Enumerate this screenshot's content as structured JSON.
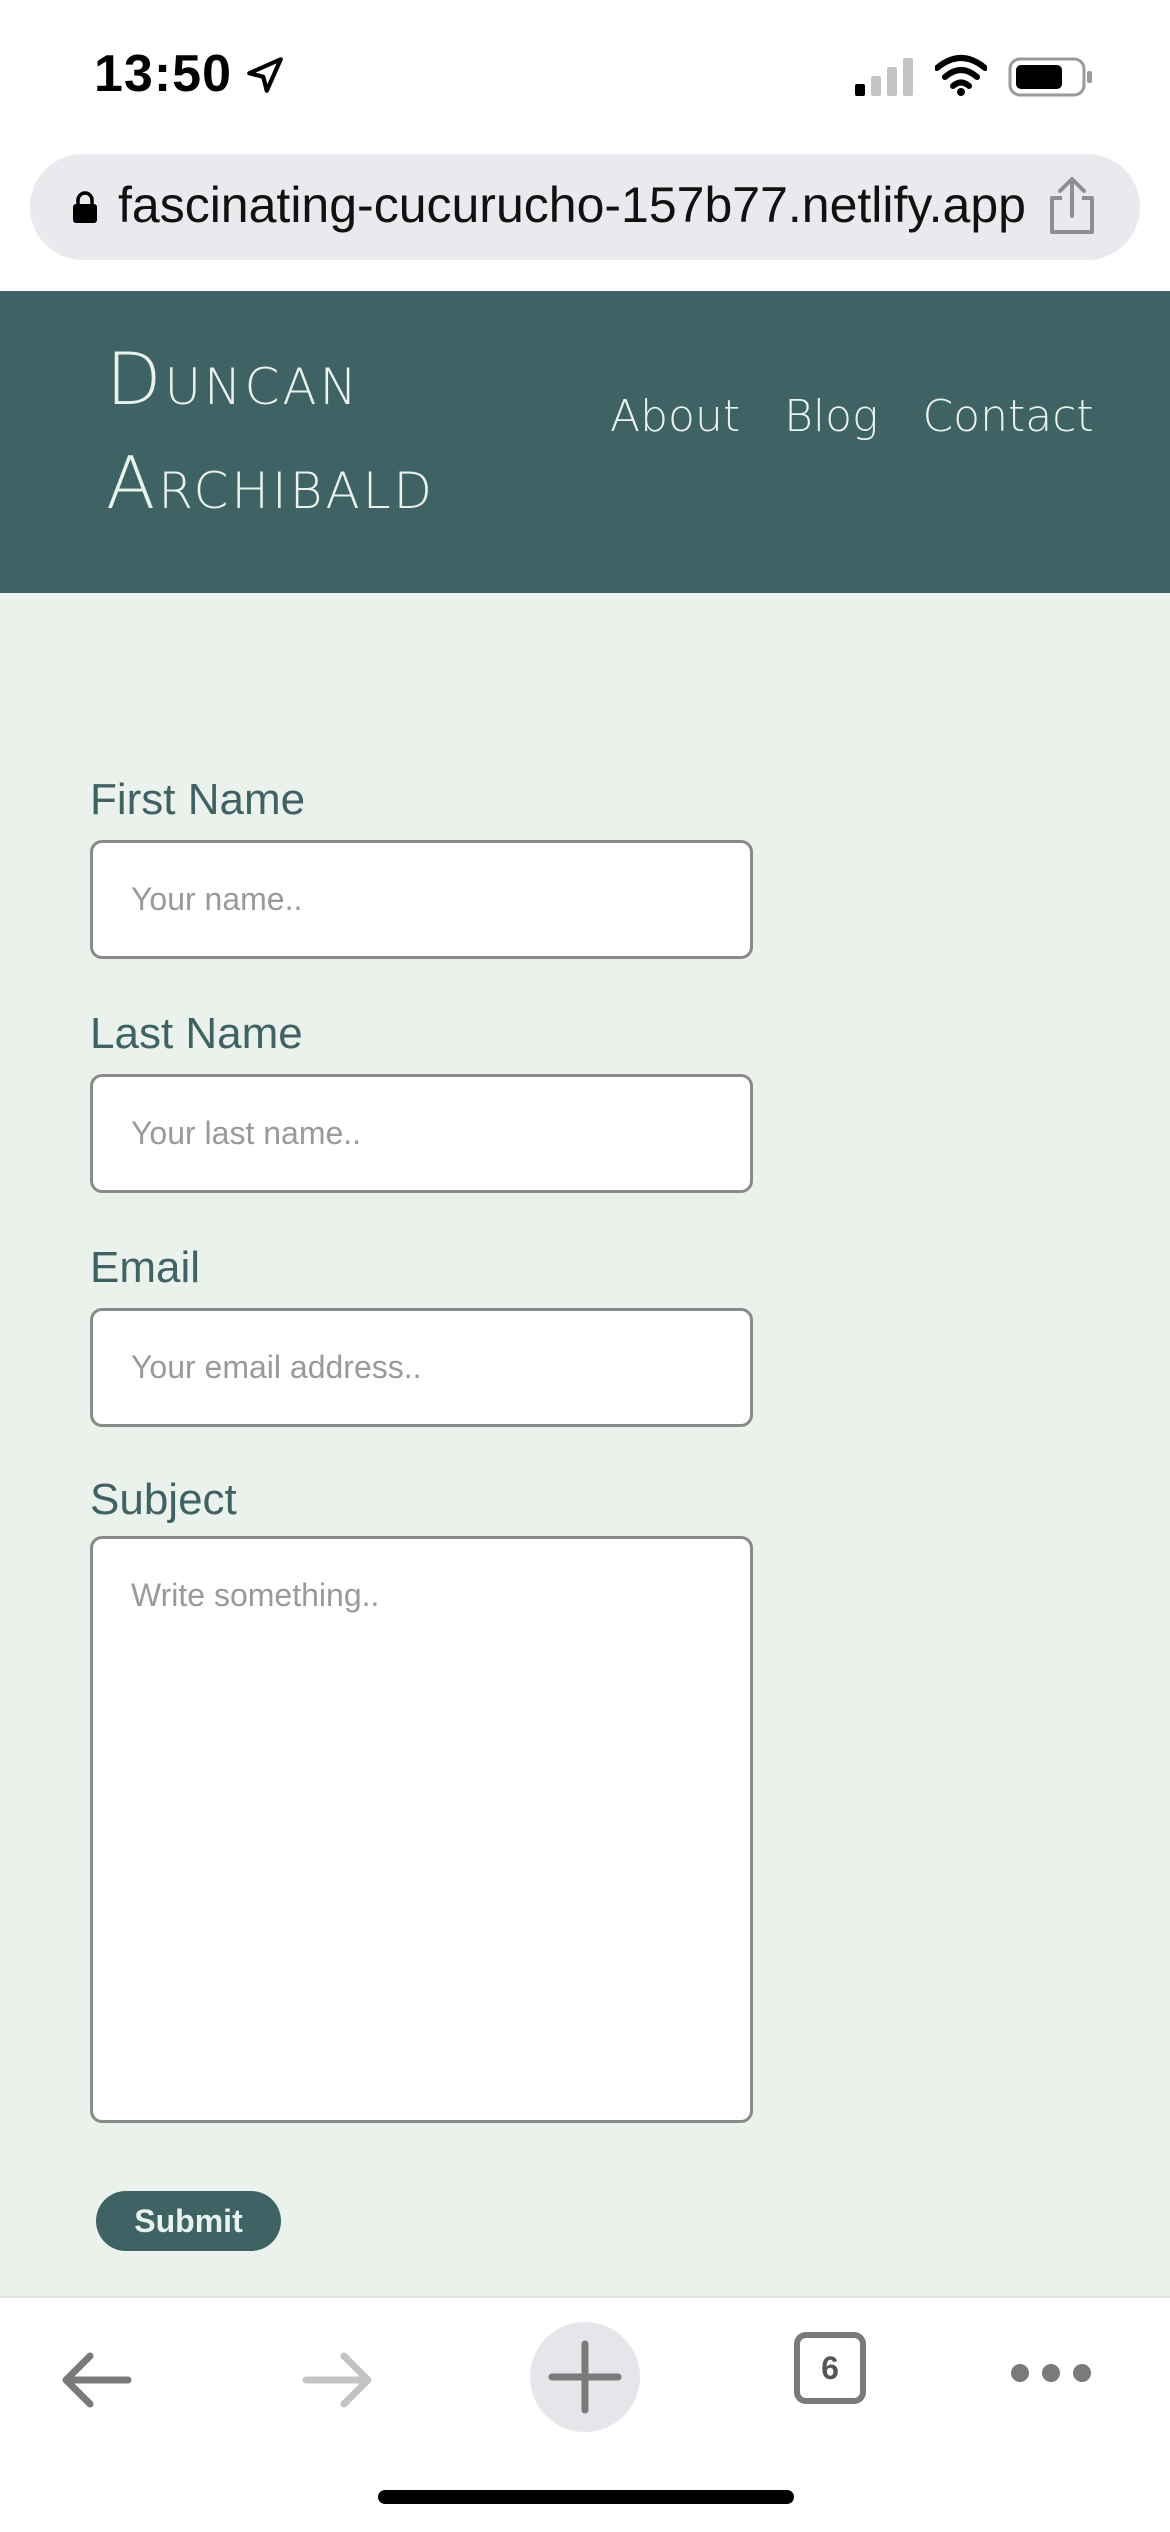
{
  "status_bar": {
    "time": "13:50"
  },
  "browser": {
    "url": "fascinating-cucurucho-157b77.netlify.app",
    "tab_count": "6"
  },
  "site": {
    "title_line1": "Duncan",
    "title_line2": "Archibald",
    "nav": [
      "About",
      "Blog",
      "Contact"
    ]
  },
  "form": {
    "first_name_label": "First Name",
    "first_name_placeholder": "Your name..",
    "last_name_label": "Last Name",
    "last_name_placeholder": "Your last name..",
    "email_label": "Email",
    "email_placeholder": "Your email address..",
    "subject_label": "Subject",
    "subject_placeholder": "Write something..",
    "submit_label": "Submit"
  },
  "colors": {
    "brand": "#3f6364",
    "background": "#ebf2eb",
    "header_text": "#eaf2ec"
  }
}
